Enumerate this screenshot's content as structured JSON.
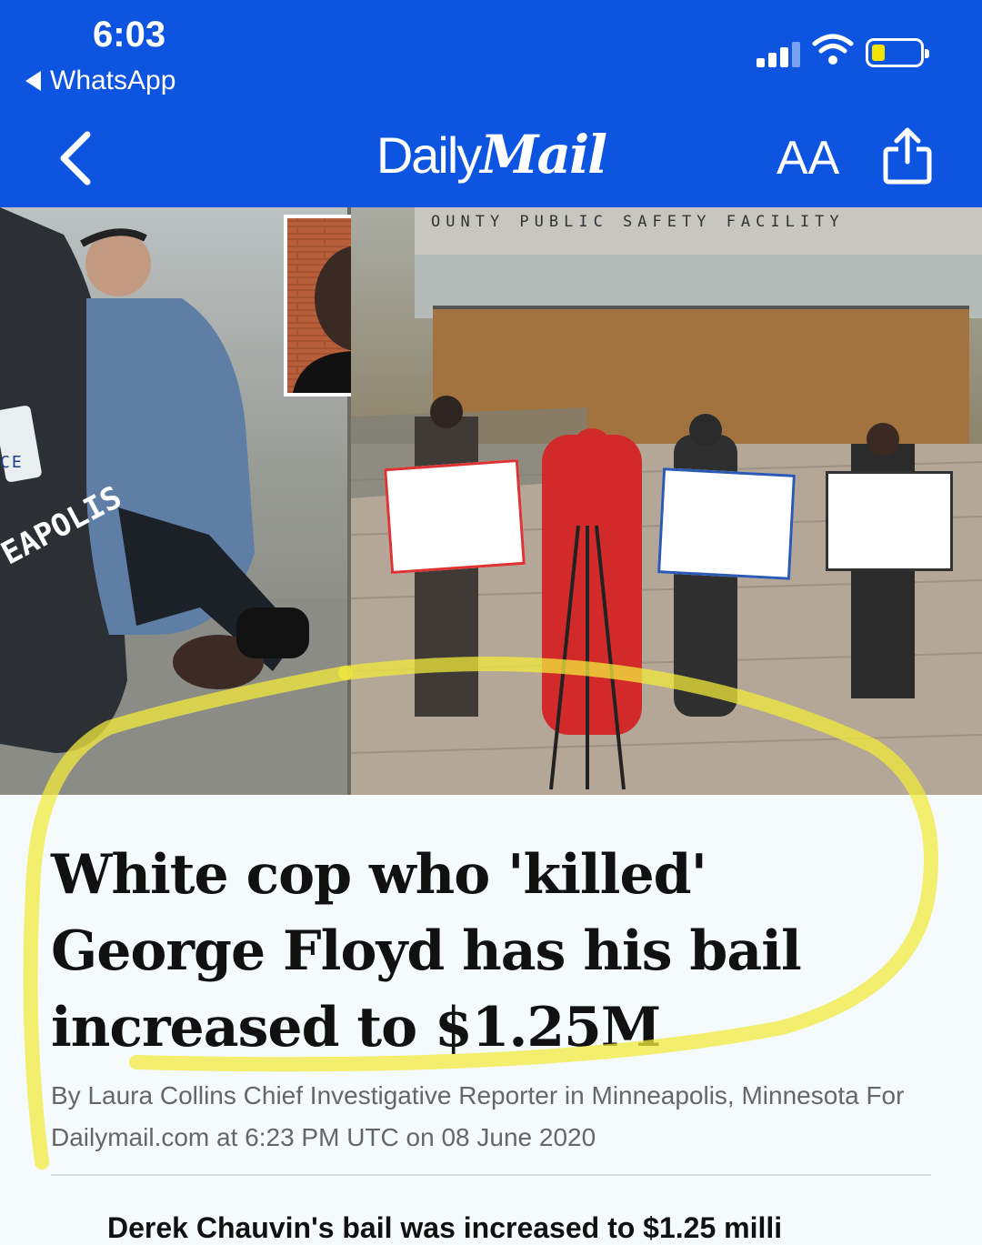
{
  "status_bar": {
    "time": "6:03",
    "back_app": "WhatsApp"
  },
  "nav": {
    "logo_daily": "Daily",
    "logo_mail": "Mail",
    "text_size_label": "AA",
    "back_icon": "chevron-left-icon",
    "share_icon": "share-icon"
  },
  "photo": {
    "facility_sign": "OUNTY PUBLIC SAFETY FACILITY",
    "car_text_1": "CE",
    "car_text_2": "EAPOLIS"
  },
  "article": {
    "headline": "White cop who 'killed' George Floyd has his bail increased to $1.25M",
    "byline": "By Laura Collins Chief Investigative Reporter in Minneapolis, Minnesota For Dailymail.com at 6:23 PM UTC on 08 June 2020",
    "teaser_partial": "Derek Chauvin's bail was increased to $1.25 milli"
  },
  "colors": {
    "brand_blue": "#0d55e0",
    "highlight_yellow": "#f2ea3c",
    "battery_yellow": "#f3e400"
  }
}
